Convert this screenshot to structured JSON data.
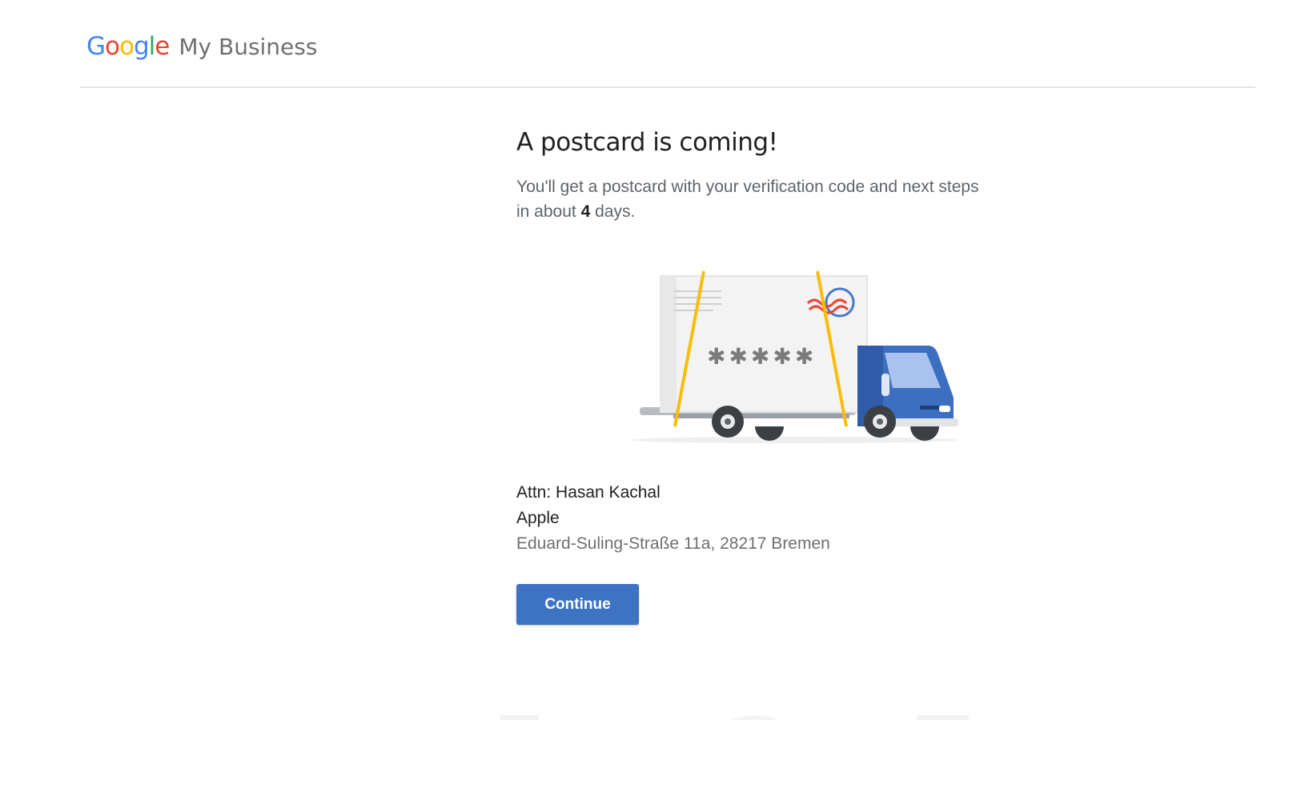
{
  "header": {
    "logo_letters": [
      "G",
      "o",
      "o",
      "g",
      "l",
      "e"
    ],
    "product_name": "My Business"
  },
  "main": {
    "title": "A postcard is coming!",
    "subtitle_before": "You'll get a postcard with your verification code and next steps in about ",
    "subtitle_days": "4",
    "subtitle_after": " days.",
    "illustration": {
      "icon": "postcard-truck-illustration",
      "code_mask": "✱✱✱✱✱"
    },
    "address": {
      "attn": "Attn: Hasan Kachal",
      "business": "Apple",
      "street": "Eduard-Suling-Straße 11a, 28217 Bremen"
    },
    "continue_label": "Continue"
  },
  "colors": {
    "google_blue": "#4285f4",
    "google_red": "#ea4335",
    "google_yellow": "#fbbc05",
    "google_green": "#34a853",
    "button_blue": "#3d73c2",
    "divider": "#e3e3e3"
  }
}
